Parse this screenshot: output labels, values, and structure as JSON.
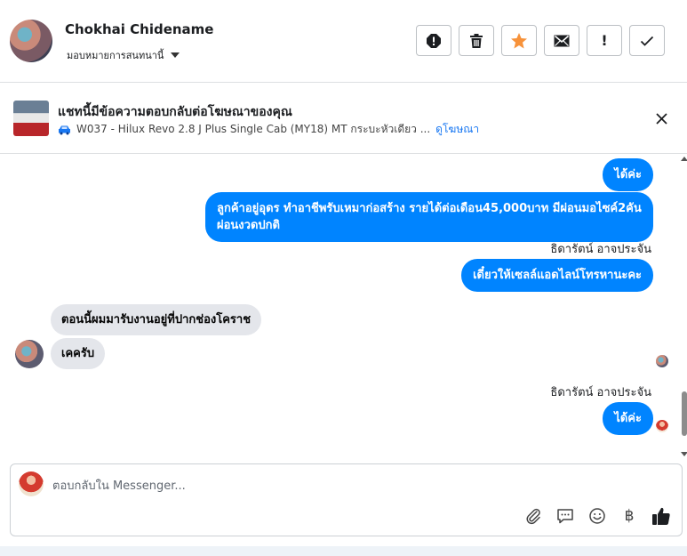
{
  "header": {
    "name": "Chokhai Chidename",
    "subtitle": "มอบหมายการสนทนานี้",
    "actions": [
      {
        "name": "report-icon"
      },
      {
        "name": "trash-icon"
      },
      {
        "name": "star-icon",
        "color": "#f7923a"
      },
      {
        "name": "mail-icon"
      },
      {
        "name": "exclaim-icon",
        "label": "!"
      },
      {
        "name": "check-icon"
      }
    ]
  },
  "ad": {
    "title": "แชทนี้มีข้อความตอบกลับต่อโฆษณาของคุณ",
    "product": "W037 - Hilux Revo 2.8 J Plus Single Cab (MY18) MT กระบะหัวเดียว ...",
    "link": "ดูโฆษณา"
  },
  "messages": {
    "m1": "ได้ค่ะ",
    "m2": "ลูกค้าอยู่อุดร ทำอาชีพรับเหมาก่อสร้าง รายได้ต่อเดือน45,000บาท มีผ่อนมอไซค์2คัน ผ่อนงวดปกติ",
    "sender1": "ธิดารัตน์ อาจประจัน",
    "m3": "เดี๋ยวให้เซลล์แอดไลน์โทรหานะคะ",
    "m4": "ตอนนี้ผมมารับงานอยู่ที่ปากช่องโคราช",
    "m5": "เคครับ",
    "sender2": "ธิดารัตน์ อาจประจัน",
    "m6": "ได้ค่ะ"
  },
  "composer": {
    "placeholder": "ตอบกลับใน Messenger...",
    "baht_symbol": "฿"
  },
  "colors": {
    "outgoing_bubble": "#0084ff",
    "incoming_bubble": "#e4e6eb",
    "link": "#1877f2"
  }
}
